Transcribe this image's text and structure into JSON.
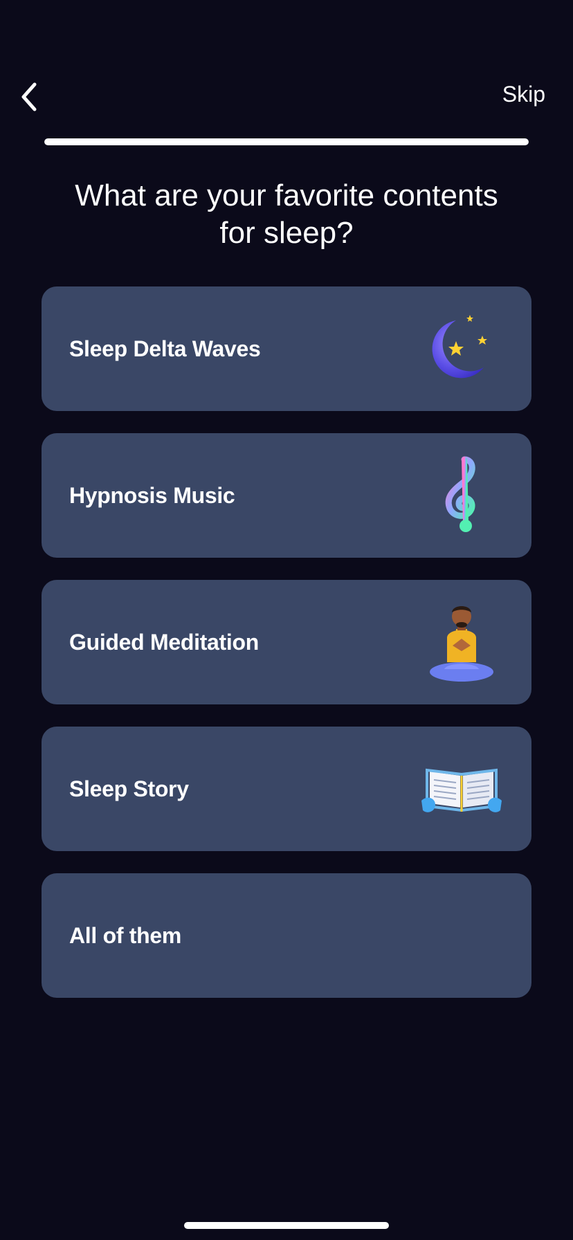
{
  "colors": {
    "background": "#0b0a1a",
    "card": "#3a4766",
    "accent": "#ffffff"
  },
  "header": {
    "back_icon": "chevron-left-icon",
    "skip_label": "Skip"
  },
  "progress": {
    "value": 1.0
  },
  "question": {
    "line1": "What are your favorite contents",
    "line2": "for sleep?"
  },
  "options": [
    {
      "label": "Sleep Delta Waves",
      "icon": "moon-stars-icon"
    },
    {
      "label": "Hypnosis Music",
      "icon": "treble-clef-icon"
    },
    {
      "label": "Guided Meditation",
      "icon": "meditating-person-icon"
    },
    {
      "label": "Sleep Story",
      "icon": "open-book-icon"
    },
    {
      "label": "All of them",
      "icon": ""
    }
  ]
}
